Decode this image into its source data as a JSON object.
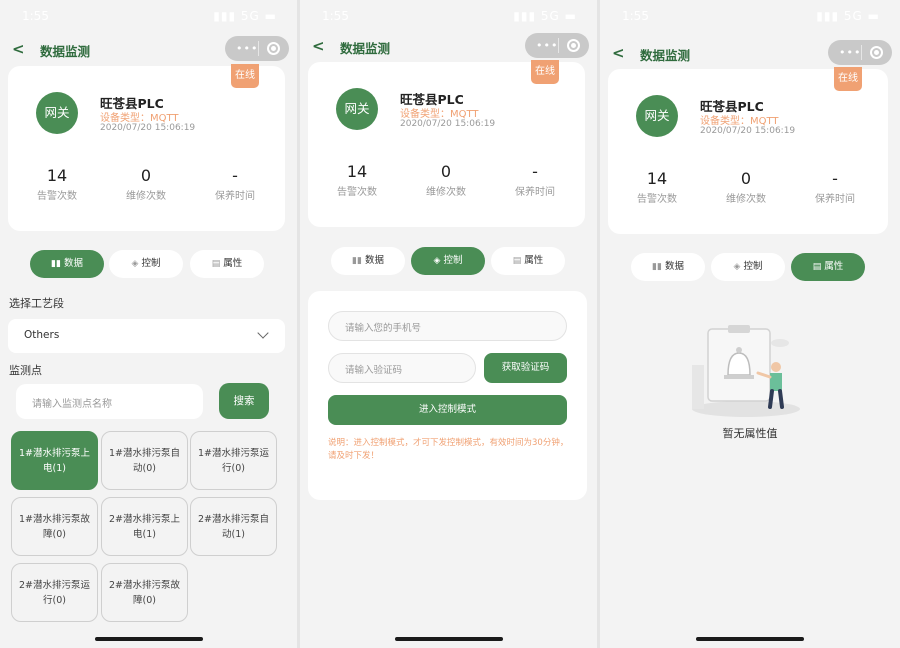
{
  "status": {
    "time": "1:55",
    "icons": "▮▮▮ 5G ▬"
  },
  "nav": {
    "title": "数据监测",
    "back_icon": "chevron-left-icon",
    "capsule_dots": "•••"
  },
  "device": {
    "badge": "在线",
    "avatar": "网关",
    "name": "旺苍县PLC",
    "type": "设备类型：MQTT",
    "time": "2020/07/20 15:06:19",
    "stats": [
      {
        "value": "14",
        "label": "告警次数"
      },
      {
        "value": "0",
        "label": "维修次数"
      },
      {
        "value": "-",
        "label": "保养时间"
      }
    ]
  },
  "tabs": [
    {
      "label": "数据",
      "icon": "bar-chart-icon"
    },
    {
      "label": "控制",
      "icon": "layers-icon"
    },
    {
      "label": "属性",
      "icon": "list-icon"
    }
  ],
  "data_view": {
    "process_label": "选择工艺段",
    "process_value": "Others",
    "monitor_label": "监测点",
    "search_placeholder": "请输入监测点名称",
    "search_button": "搜索",
    "points": [
      {
        "line1": "1#潜水排污泵上",
        "line2": "电(1)"
      },
      {
        "line1": "1#潜水排污泵自",
        "line2": "动(0)"
      },
      {
        "line1": "1#潜水排污泵运",
        "line2": "行(0)"
      },
      {
        "line1": "1#潜水排污泵故",
        "line2": "障(0)"
      },
      {
        "line1": "2#潜水排污泵上",
        "line2": "电(1)"
      },
      {
        "line1": "2#潜水排污泵自",
        "line2": "动(1)"
      },
      {
        "line1": "2#潜水排污泵运",
        "line2": "行(0)"
      },
      {
        "line1": "2#潜水排污泵故",
        "line2": "障(0)"
      }
    ]
  },
  "control_view": {
    "phone_placeholder": "请输入您的手机号",
    "code_placeholder": "请输入验证码",
    "code_button": "获取验证码",
    "enter_button": "进入控制模式",
    "note": "说明：进入控制模式，才可下发控制模式，有效时间为30分钟，请及时下发！"
  },
  "attr_view": {
    "empty_text": "暂无属性值"
  },
  "colors": {
    "accent": "#4a8d55",
    "badge": "#f0a173",
    "background": "#f3f3f3"
  }
}
